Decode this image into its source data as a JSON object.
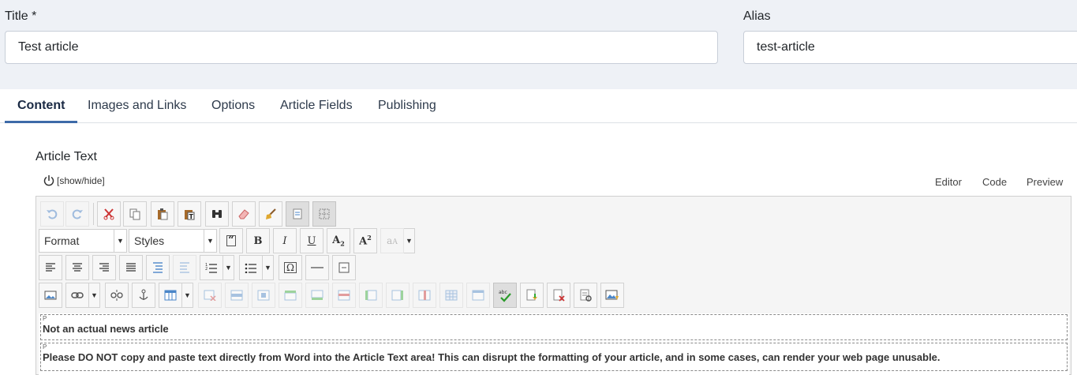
{
  "title_field": {
    "label": "Title *",
    "value": "Test article"
  },
  "alias_field": {
    "label": "Alias",
    "value": "test-article"
  },
  "tabs": [
    {
      "label": "Content",
      "active": true
    },
    {
      "label": "Images and Links",
      "active": false
    },
    {
      "label": "Options",
      "active": false
    },
    {
      "label": "Article Fields",
      "active": false
    },
    {
      "label": "Publishing",
      "active": false
    }
  ],
  "editor": {
    "label": "Article Text",
    "show_hide": "[show/hide]",
    "modes": [
      "Editor",
      "Code",
      "Preview"
    ],
    "format_select": "Format",
    "styles_select": "Styles",
    "paragraphs": [
      {
        "tag": "P",
        "text": "Not an actual news article"
      },
      {
        "tag": "P",
        "text": "Please DO NOT copy and paste text directly from Word into the Article Text area! This can disrupt the formatting of your article, and in some cases, can render your web page unusable."
      }
    ]
  },
  "colors": {
    "accent": "#3d6aa8",
    "page_bg": "#eef1f6"
  }
}
